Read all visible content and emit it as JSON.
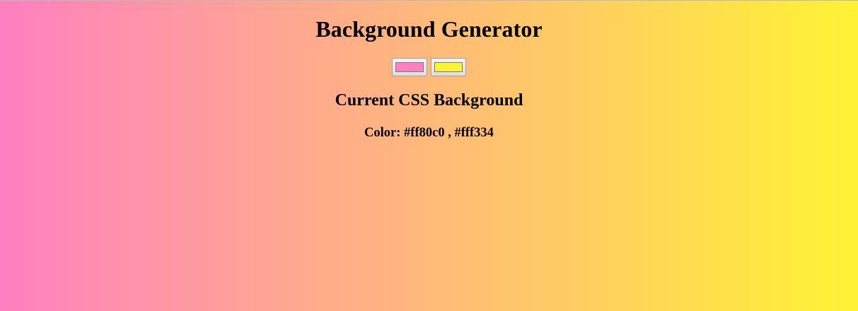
{
  "title": "Background Generator",
  "subtitle": "Current CSS Background",
  "color_label": "Color:",
  "colors": {
    "color1": "#ff80c0",
    "color2": "#fff334"
  },
  "color_readout": "#ff80c0 , #fff334"
}
